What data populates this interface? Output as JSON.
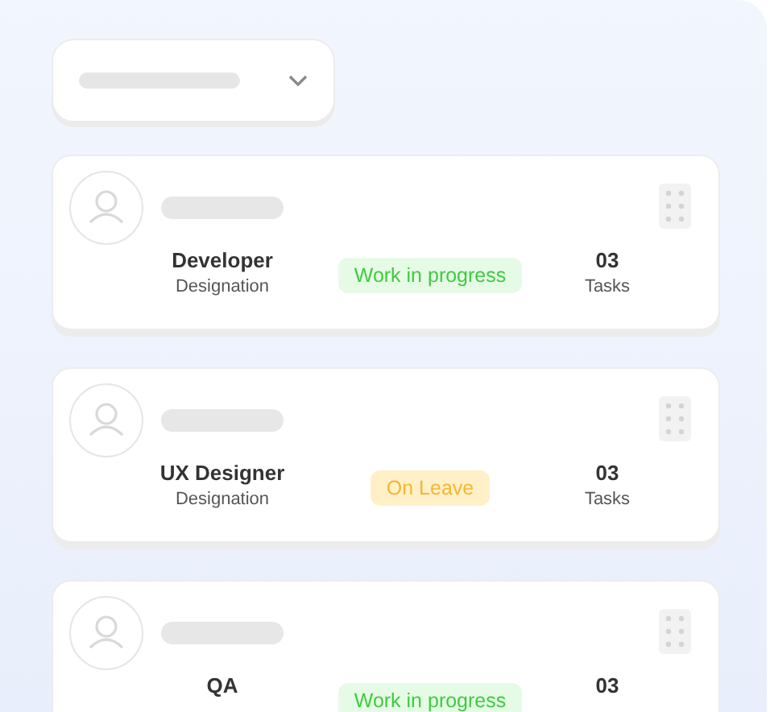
{
  "dropdown": {
    "expanded": false
  },
  "cards": [
    {
      "title": "Developer",
      "subtitle": "Designation",
      "status": {
        "label": "Work in progress",
        "kind": "in_progress"
      },
      "count": "03",
      "count_label": "Tasks"
    },
    {
      "title": "UX Designer",
      "subtitle": "Designation",
      "status": {
        "label": "On Leave",
        "kind": "on_leave"
      },
      "count": "03",
      "count_label": "Tasks"
    },
    {
      "title": "QA",
      "status": {
        "label": "Work in progress",
        "kind": "in_progress"
      },
      "count": "03"
    }
  ]
}
